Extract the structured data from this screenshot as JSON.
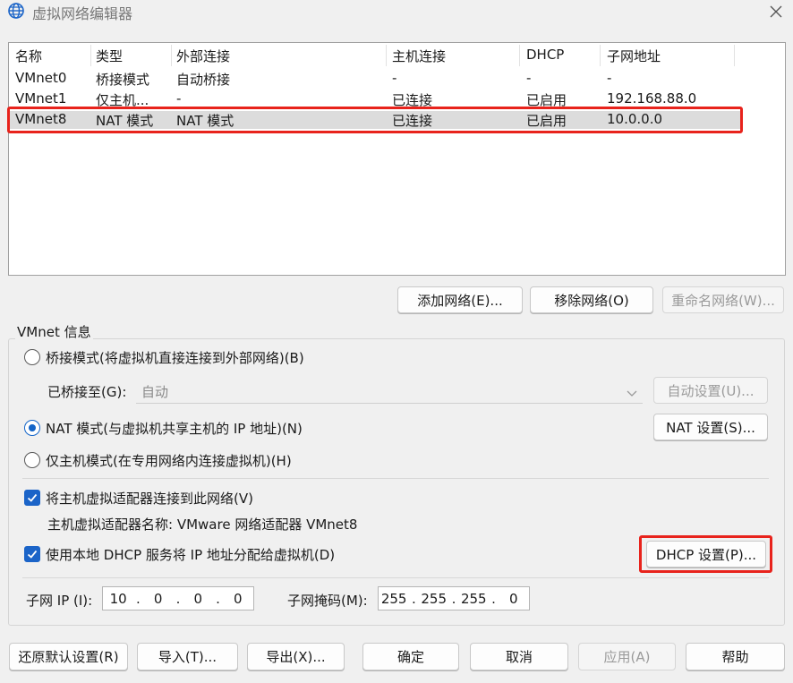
{
  "window": {
    "title": "虚拟网络编辑器",
    "icon": "globe-icon"
  },
  "network_table": {
    "headers": [
      "名称",
      "类型",
      "外部连接",
      "主机连接",
      "DHCP",
      "子网地址"
    ],
    "rows": [
      [
        "VMnet0",
        "桥接模式",
        "自动桥接",
        "-",
        "-",
        "-"
      ],
      [
        "VMnet1",
        "仅主机...",
        "-",
        "已连接",
        "已启用",
        "192.168.88.0"
      ],
      [
        "VMnet8",
        "NAT 模式",
        "NAT 模式",
        "已连接",
        "已启用",
        "10.0.0.0"
      ]
    ],
    "selected_row": 2
  },
  "list_buttons": {
    "add": "添加网络(E)...",
    "remove": "移除网络(O)",
    "rename": "重命名网络(W)..."
  },
  "vmnet_info": {
    "title": "VMnet 信息",
    "bridged_radio": "桥接模式(将虚拟机直接连接到外部网络)(B)",
    "bridged_to_label": "已桥接至(G):",
    "bridged_to_value": "自动",
    "auto_settings_btn": "自动设置(U)...",
    "nat_radio": "NAT 模式(与虚拟机共享主机的 IP 地址)(N)",
    "nat_settings_btn": "NAT 设置(S)...",
    "hostonly_radio": "仅主机模式(在专用网络内连接虚拟机)(H)",
    "selected_mode": "nat",
    "connect_adapter_check": "将主机虚拟适配器连接到此网络(V)",
    "adapter_name": "主机虚拟适配器名称: VMware 网络适配器 VMnet8",
    "dhcp_check": "使用本地 DHCP 服务将 IP 地址分配给虚拟机(D)",
    "dhcp_settings_btn": "DHCP 设置(P)...",
    "subnet_ip_label": "子网 IP (I):",
    "subnet_ip": [
      "10",
      "0",
      "0",
      "0"
    ],
    "subnet_mask_label": "子网掩码(M):",
    "subnet_mask": [
      "255",
      "255",
      "255",
      "0"
    ]
  },
  "bottom_buttons": {
    "restore": "还原默认设置(R)",
    "import": "导入(T)...",
    "export": "导出(X)...",
    "ok": "确定",
    "cancel": "取消",
    "apply": "应用(A)",
    "help": "帮助"
  },
  "colors": {
    "highlight": "#e8231c",
    "accent": "#1264c8",
    "selected_row": "#dcdcdc"
  }
}
